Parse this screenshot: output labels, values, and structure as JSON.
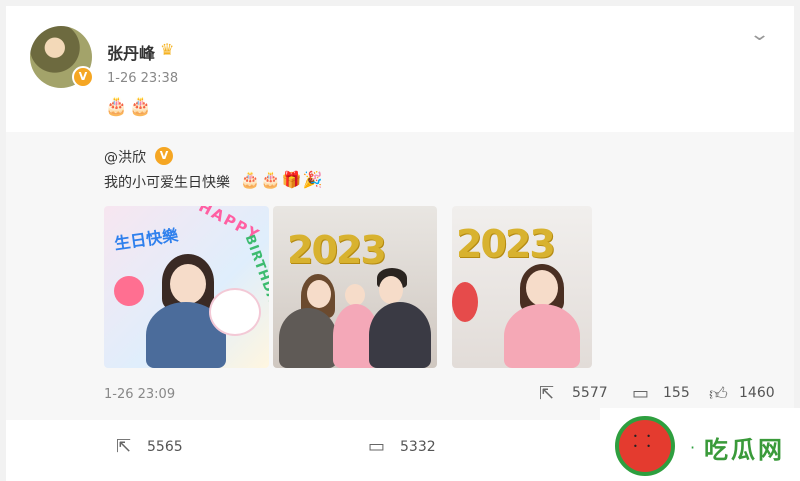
{
  "post": {
    "username": "张丹峰",
    "time": "1-26 23:38",
    "emoji": "🎂🎂",
    "crown_icon": "crown-icon",
    "chevron_icon": "chevron-down-icon"
  },
  "repost": {
    "mention": "@洪欣",
    "text": "我的小可爱生日快樂",
    "emoji": "🎂🎂🎁🎉",
    "time": "1-26 23:09",
    "metrics": {
      "shares": "5577",
      "comments": "155",
      "likes": "1460"
    },
    "photos": [
      {
        "overlay_title": "生日快樂",
        "banner": "HAPPY",
        "banner2": "BIRTHDAY"
      },
      {
        "balloon_text": "2023"
      },
      {
        "balloon_text": "2023"
      }
    ]
  },
  "actions": {
    "share_count": "5565",
    "comment_count": "5332"
  },
  "watermark": {
    "text": "吃瓜网",
    "separator": "·"
  },
  "colors": {
    "accent_gold": "#f5a623",
    "balloon_gold": "#d8b22f",
    "watermark_green": "#3a9a3a",
    "watermark_red": "#e43b2f"
  }
}
